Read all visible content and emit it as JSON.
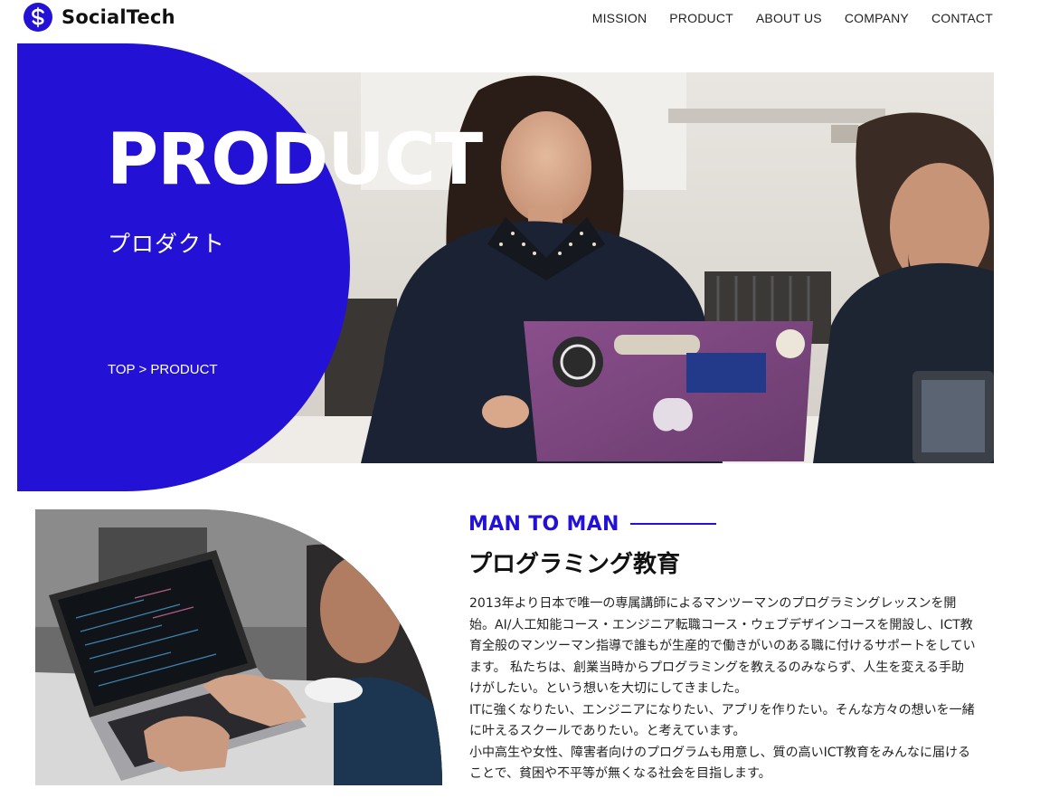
{
  "header": {
    "logo_text": "SocialTech",
    "nav": [
      "MISSION",
      "PRODUCT",
      "ABOUT US",
      "COMPANY",
      "CONTACT"
    ]
  },
  "hero": {
    "title": "PRODUCT",
    "subtitle": "プロダクト",
    "breadcrumb": {
      "home": "TOP",
      "separator": ">",
      "current": "PRODUCT"
    }
  },
  "section": {
    "kicker": "MAN TO MAN",
    "title": "プログラミング教育",
    "paragraphs": [
      "2013年より日本で唯一の専属講師によるマンツーマンのプログラミングレッスンを開始。AI/人工知能コース・エンジニア転職コース・ウェブデザインコースを開設し、ICT教育全般のマンツーマン指導で誰もが生産的で働きがいのある職に付けるサポートをしています。 私たちは、創業当時からプログラミングを教えるのみならず、人生を変える手助けがしたい。という想いを大切にしてきました。",
      "ITに強くなりたい、エンジニアになりたい、アプリを作りたい。そんな方々の想いを一緒に叶えるスクールでありたい。と考えています。",
      "小中高生や女性、障害者向けのプログラムも用意し、質の高いICT教育をみんなに届けることで、貧困や不平等が無くなる社会を目指します。"
    ]
  },
  "colors": {
    "brand": "#2312d6",
    "text": "#222222",
    "background": "#ffffff"
  },
  "icons": {
    "logo": "social-tech-logo-icon",
    "hero_image": "woman-with-laptop-photo",
    "section_image": "hands-typing-on-laptop-photo"
  }
}
